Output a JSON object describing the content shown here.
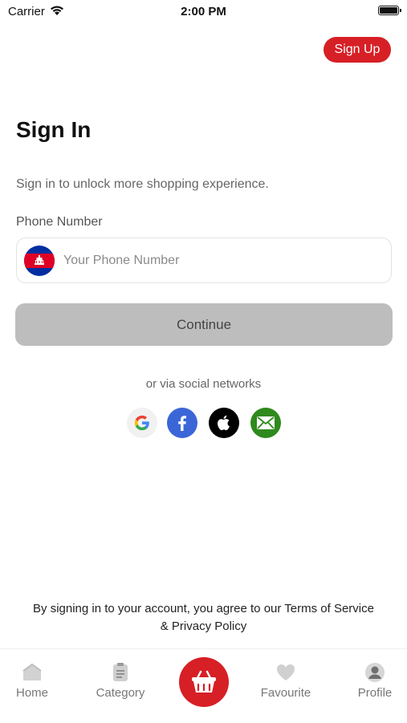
{
  "status_bar": {
    "carrier": "Carrier",
    "time": "2:00 PM"
  },
  "header": {
    "signup_label": "Sign Up"
  },
  "signin": {
    "title": "Sign In",
    "subtitle": "Sign in to unlock more shopping experience.",
    "phone_label": "Phone Number",
    "phone_placeholder": "Your Phone Number",
    "phone_value": "",
    "continue_label": "Continue"
  },
  "social": {
    "label": "or via social networks",
    "networks": [
      "google-icon",
      "facebook-icon",
      "apple-icon",
      "email-icon"
    ]
  },
  "terms": "By signing in to your account, you agree to our Terms of Service & Privacy Policy",
  "tabbar": {
    "items": [
      {
        "label": "Home",
        "icon": "home-icon"
      },
      {
        "label": "Category",
        "icon": "category-icon"
      },
      {
        "label": "",
        "icon": "cart-icon"
      },
      {
        "label": "Favourite",
        "icon": "heart-icon"
      },
      {
        "label": "Profile",
        "icon": "profile-icon"
      }
    ]
  },
  "colors": {
    "accent": "#d71f26",
    "disabled_button": "#bdbdbd",
    "facebook": "#3b66d8",
    "email": "#2f8a1d"
  }
}
